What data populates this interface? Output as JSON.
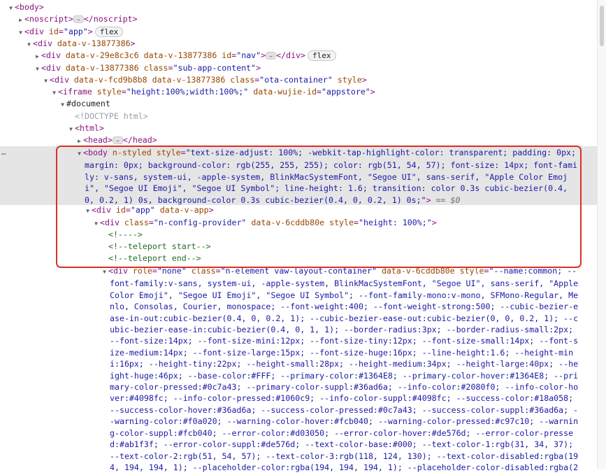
{
  "colors": {
    "tag": "#881280",
    "attr_name": "#994500",
    "attr_value": "#1a1aa6",
    "comment": "#236e25",
    "highlight_bg": "#e5e5e5",
    "annotation": "#d93025"
  },
  "badges": {
    "flex": "flex",
    "dollar0": "== $0",
    "ellipsis": "…",
    "row_dots": "…"
  },
  "l1": {
    "open": "<body>"
  },
  "l2": {
    "open": "<noscript>",
    "close": "</noscript>"
  },
  "l3": {
    "open": "<div",
    "a1n": "id",
    "a1v": "\"app\"",
    "end": ">"
  },
  "l4": {
    "open": "<div",
    "a1n": "data-v-13877386",
    "end": ">"
  },
  "l5": {
    "open": "<div",
    "a1n": "data-v-29e8c3c6",
    "a2n": "data-v-13877386",
    "a3n": "id",
    "a3v": "\"nav\"",
    "end": ">",
    "close": "</div>"
  },
  "l6": {
    "open": "<div",
    "a1n": "data-v-13877386",
    "a2n": "class",
    "a2v": "\"sub-app-content\"",
    "end": ">"
  },
  "l7": {
    "open": "<div",
    "a1n": "data-v-fcd9b8b8",
    "a2n": "data-v-13877386",
    "a3n": "class",
    "a3v": "\"ota-container\"",
    "a4n": "style",
    "end": ">"
  },
  "l8": {
    "open": "<iframe",
    "a1n": "style",
    "a1v": "\"height:100%;width:100%;\"",
    "a2n": "data-wujie-id",
    "a2v": "\"appstore\"",
    "end": ">"
  },
  "l9": {
    "text": "#document"
  },
  "l10": {
    "text": "<!DOCTYPE html>"
  },
  "l11": {
    "open": "<html>"
  },
  "l12": {
    "open": "<head>",
    "close": "</head>"
  },
  "body_wrap": {
    "line1_tag": "<body",
    "line1_an1": "n-styled",
    "line1_an2": "style",
    "line1_av": "\"text-size-adjust: 100%; -webkit-tap-highlight-color: transparent; padding: 0px;",
    "line1_tail": "font-fami",
    "line2": "margin: 0px; background-color: rgb(255, 255, 255); color: rgb(51, 54, 57); font-size: 14px; font-fami",
    "line3": "ly: v-sans, system-ui, -apple-system, BlinkMacSystemFont, \"Segoe UI\", sans-serif, \"Apple Color Emoj",
    "line4": "i\", \"Segoe UI Emoji\", \"Segoe UI Symbol\"; line-height: 1.6; transition: color 0.3s cubic-bezier(0.4,",
    "line5_av": "0, 0.2, 1) 0s, background-color 0.3s cubic-bezier(0.4, 0, 0.2, 1) 0s;\"",
    "line5_end": ">"
  },
  "l13": {
    "open": "<div",
    "a1n": "id",
    "a1v": "\"app\"",
    "a2n": "data-v-app",
    "end": ">"
  },
  "l14": {
    "open": "<div",
    "a1n": "class",
    "a1v": "\"n-config-provider\"",
    "a2n": "data-v-6cddb80e",
    "a3n": "style",
    "a3v": "\"height: 100%;\"",
    "end": ">"
  },
  "l15": {
    "text": "<!---->"
  },
  "l16": {
    "text": "<!--teleport start-->"
  },
  "l17": {
    "text": "<!--teleport end-->"
  },
  "div_wrap": {
    "line1_tag": "<div",
    "line1_an1": "role",
    "line1_av1": "\"none\"",
    "line1_an2": "class",
    "line1_av2": "\"n-element vaw-layout-container\"",
    "line1_an3": "data-v-6cddb80e",
    "line1_an4": "style",
    "line1_av4": "\"--name:common; --",
    "lines": [
      "font-family:v-sans, system-ui, -apple-system, BlinkMacSystemFont, \"Segoe UI\", sans-serif, \"Apple",
      "Color Emoji\", \"Segoe UI Emoji\", \"Segoe UI Symbol\"; --font-family-mono:v-mono, SFMono-Regular, Me",
      "nlo, Consolas, Courier, monospace; --font-weight:400; --font-weight-strong:500; --cubic-bezier-e",
      "ase-in-out:cubic-bezier(0.4, 0, 0.2, 1); --cubic-bezier-ease-out:cubic-bezier(0, 0, 0.2, 1); --c",
      "ubic-bezier-ease-in:cubic-bezier(0.4, 0, 1, 1); --border-radius:3px; --border-radius-small:2px;",
      "--font-size:14px; --font-size-mini:12px; --font-size-tiny:12px; --font-size-small:14px; --font-s",
      "ize-medium:14px; --font-size-large:15px; --font-size-huge:16px; --line-height:1.6; --height-min",
      "i:16px; --height-tiny:22px; --height-small:28px; --height-medium:34px; --height-large:40px; --he",
      "ight-huge:46px; --base-color:#FFF; --primary-color:#1364E8; --primary-color-hover:#1364E8; --pri",
      "mary-color-pressed:#0c7a43; --primary-color-suppl:#36ad6a; --info-color:#2080f0; --info-color-ho",
      "ver:#4098fc; --info-color-pressed:#1060c9; --info-color-suppl:#4098fc; --success-color:#18a058;",
      "--success-color-hover:#36ad6a; --success-color-pressed:#0c7a43; --success-color-suppl:#36ad6a; -",
      "-warning-color:#f0a020; --warning-color-hover:#fcb040; --warning-color-pressed:#c97c10; --warnin",
      "g-color-suppl:#fcb040; --error-color:#d03050; --error-color-hover:#de576d; --error-color-presse",
      "d:#ab1f3f; --error-color-suppl:#de576d; --text-color-base:#000; --text-color-1:rgb(31, 34, 37);",
      "--text-color-2:rgb(51, 54, 57); --text-color-3:rgb(118, 124, 130); --text-color-disabled:rgba(19",
      "4, 194, 194, 1); --placeholder-color:rgba(194, 194, 194, 1); --placeholder-color-disabled:rgba(2"
    ]
  }
}
